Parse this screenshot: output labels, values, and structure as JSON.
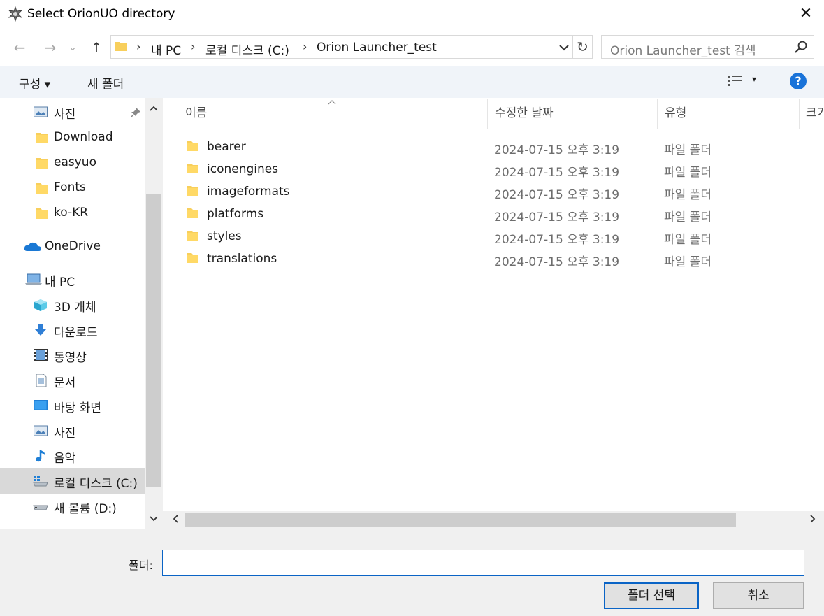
{
  "window": {
    "title": "Select OrionUO directory",
    "close_glyph": "✕"
  },
  "nav": {
    "back_glyph": "←",
    "forward_glyph": "→",
    "recent_glyph": "⌄",
    "up_glyph": "↑",
    "breadcrumbs": [
      "내 PC",
      "로컬 디스크 (C:)",
      "Orion Launcher_test"
    ],
    "separator": "›",
    "refresh_glyph": "↻",
    "search_placeholder": "Orion Launcher_test 검색"
  },
  "commands": {
    "organize": "구성 ▾",
    "new_folder": "새 폴더",
    "view_dropdown": "▾",
    "help": "?"
  },
  "sidebar": {
    "items": [
      {
        "label": "사진",
        "icon": "pictures-icon",
        "pinned": true
      },
      {
        "label": "Download",
        "icon": "folder-icon"
      },
      {
        "label": "easyuo",
        "icon": "folder-icon"
      },
      {
        "label": "Fonts",
        "icon": "folder-icon"
      },
      {
        "label": "ko-KR",
        "icon": "folder-icon"
      },
      {
        "label": "OneDrive",
        "icon": "onedrive-icon"
      },
      {
        "label": "내 PC",
        "icon": "pc-icon"
      },
      {
        "label": "3D 개체",
        "icon": "3d-objects-icon"
      },
      {
        "label": "다운로드",
        "icon": "downloads-icon"
      },
      {
        "label": "동영상",
        "icon": "videos-icon"
      },
      {
        "label": "문서",
        "icon": "documents-icon"
      },
      {
        "label": "바탕 화면",
        "icon": "desktop-icon"
      },
      {
        "label": "사진",
        "icon": "pictures-icon"
      },
      {
        "label": "음악",
        "icon": "music-icon"
      },
      {
        "label": "로컬 디스크 (C:)",
        "icon": "local-disk-icon",
        "selected": true
      },
      {
        "label": "새 볼륨 (D:)",
        "icon": "drive-icon"
      }
    ]
  },
  "filelist": {
    "columns": {
      "name": "이름",
      "modified": "수정한 날짜",
      "type": "유형",
      "size": "크기"
    },
    "rows": [
      {
        "name": "bearer",
        "modified": "2024-07-15 오후 3:19",
        "type": "파일 폴더"
      },
      {
        "name": "iconengines",
        "modified": "2024-07-15 오후 3:19",
        "type": "파일 폴더"
      },
      {
        "name": "imageformats",
        "modified": "2024-07-15 오후 3:19",
        "type": "파일 폴더"
      },
      {
        "name": "platforms",
        "modified": "2024-07-15 오후 3:19",
        "type": "파일 폴더"
      },
      {
        "name": "styles",
        "modified": "2024-07-15 오후 3:19",
        "type": "파일 폴더"
      },
      {
        "name": "translations",
        "modified": "2024-07-15 오후 3:19",
        "type": "파일 폴더"
      }
    ]
  },
  "footer": {
    "folder_label": "폴더:",
    "folder_value": "",
    "select_button": "폴더 선택",
    "cancel_button": "취소"
  },
  "colors": {
    "folder": "#f8cf5c",
    "accent": "#0a64c6",
    "command_bar": "#f0f4f9"
  }
}
